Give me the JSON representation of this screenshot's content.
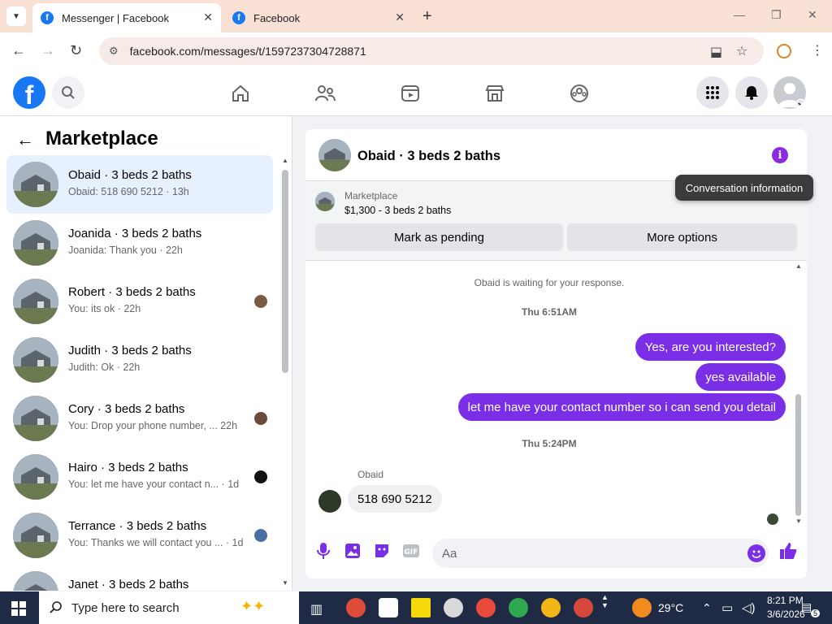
{
  "browser": {
    "tabs": [
      {
        "label": "Messenger | Facebook",
        "active": true
      },
      {
        "label": "Facebook",
        "active": false
      }
    ],
    "url": "facebook.com/messages/t/1597237304728871",
    "close_glyph": "✕",
    "new_tab_glyph": "+"
  },
  "left_pane": {
    "title": "Marketplace",
    "conversations": [
      {
        "name": "Obaid · 3 beds 2 baths",
        "preview": "Obaid: 518 690 5212",
        "time": "13h"
      },
      {
        "name": "Joanida · 3 beds 2 baths",
        "preview": "Joanida: Thank you",
        "time": "22h"
      },
      {
        "name": "Robert · 3 beds 2 baths",
        "preview": "You: its ok",
        "time": "22h"
      },
      {
        "name": "Judith · 3 beds 2 baths",
        "preview": "Judith: Ok",
        "time": "22h"
      },
      {
        "name": "Cory · 3 beds 2 baths",
        "preview": "You: Drop your phone number, ...",
        "time": "22h"
      },
      {
        "name": "Hairo · 3 beds 2 baths",
        "preview": "You: let me have your contact n...",
        "time": "1d"
      },
      {
        "name": "Terrance · 3 beds 2 baths",
        "preview": "You: Thanks we will contact you ...",
        "time": "1d"
      },
      {
        "name": "Janet · 3 beds 2 baths",
        "preview": "",
        "time": ""
      }
    ]
  },
  "chat": {
    "title": "Obaid · 3 beds 2 baths",
    "marketplace_label": "Marketplace",
    "listing": "$1,300 - 3 beds 2 baths",
    "mark_pending_label": "Mark as pending",
    "more_options_label": "More options",
    "waiting_text": "Obaid is waiting for your response.",
    "time_1": "Thu 6:51AM",
    "outgoing": [
      "Yes, are you interested?",
      "yes available",
      "let me have your contact number so i can send you detail"
    ],
    "time_2": "Thu 5:24PM",
    "sender_name": "Obaid",
    "incoming": "518 690 5212",
    "input_placeholder": "Aa",
    "tooltip": "Conversation information"
  },
  "taskbar": {
    "search_placeholder": "Type here to search",
    "weather": "29°C",
    "time": "8:21 PM",
    "date": "3/6/2026",
    "notification_count": "5"
  },
  "colors": {
    "accent": "#7a2ee6",
    "fb_blue": "#1877f2",
    "tab_bar": "#f9e1d6"
  }
}
